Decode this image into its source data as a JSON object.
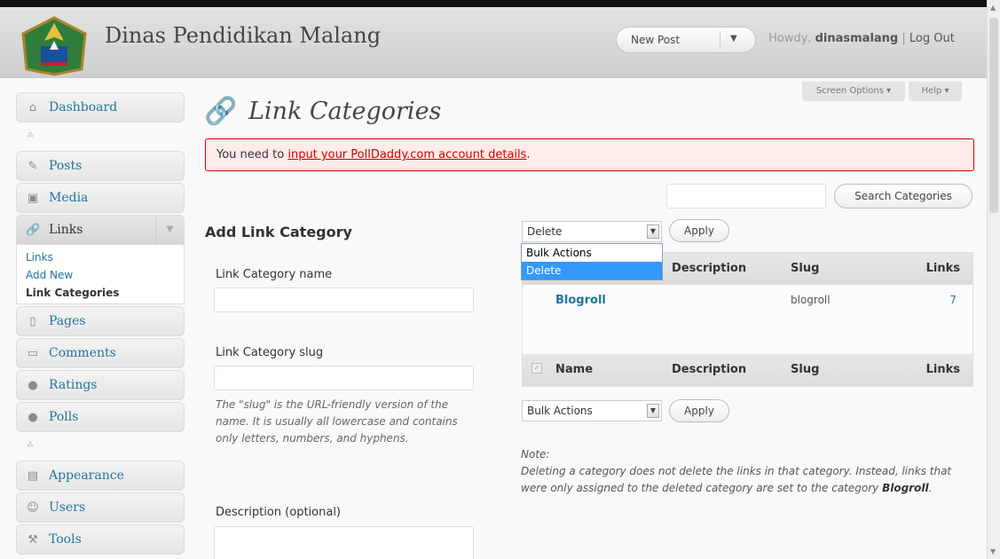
{
  "header": {
    "site_title": "Dinas Pendidikan Malang",
    "favorite_action": "New Post",
    "howdy_prefix": "Howdy,",
    "username": "dinasmalang",
    "logout": "Log Out"
  },
  "menu": {
    "dashboard": "Dashboard",
    "posts": "Posts",
    "media": "Media",
    "links": "Links",
    "links_sub": [
      "Links",
      "Add New",
      "Link Categories"
    ],
    "pages": "Pages",
    "comments": "Comments",
    "ratings": "Ratings",
    "polls": "Polls",
    "appearance": "Appearance",
    "users": "Users",
    "tools": "Tools"
  },
  "screen_options": "Screen Options",
  "help": "Help",
  "page_title": "Link Categories",
  "notice": {
    "prefix": "You need to ",
    "link": "input your PollDaddy.com account details",
    "suffix": "."
  },
  "search": {
    "value": "",
    "button": "Search Categories"
  },
  "add_form": {
    "heading": "Add Link Category",
    "name_label": "Link Category name",
    "slug_label": "Link Category slug",
    "slug_help": "The \"slug\" is the URL-friendly version of the name. It is usually all lowercase and contains only letters, numbers, and hyphens.",
    "description_label": "Description (optional)"
  },
  "bulk_top": {
    "selected": "Delete",
    "options": [
      "Bulk Actions",
      "Delete"
    ],
    "apply": "Apply"
  },
  "table": {
    "columns": [
      "Name",
      "Description",
      "Slug",
      "Links"
    ],
    "rows": [
      {
        "name": "Blogroll",
        "description": "",
        "slug": "blogroll",
        "links": "7"
      }
    ]
  },
  "bulk_bottom": {
    "selected": "Bulk Actions",
    "apply": "Apply"
  },
  "note": {
    "heading": "Note:",
    "text": "Deleting a category does not delete the links in that category. Instead, links that were only assigned to the deleted category are set to the category",
    "category": "Blogroll",
    "end": "."
  }
}
